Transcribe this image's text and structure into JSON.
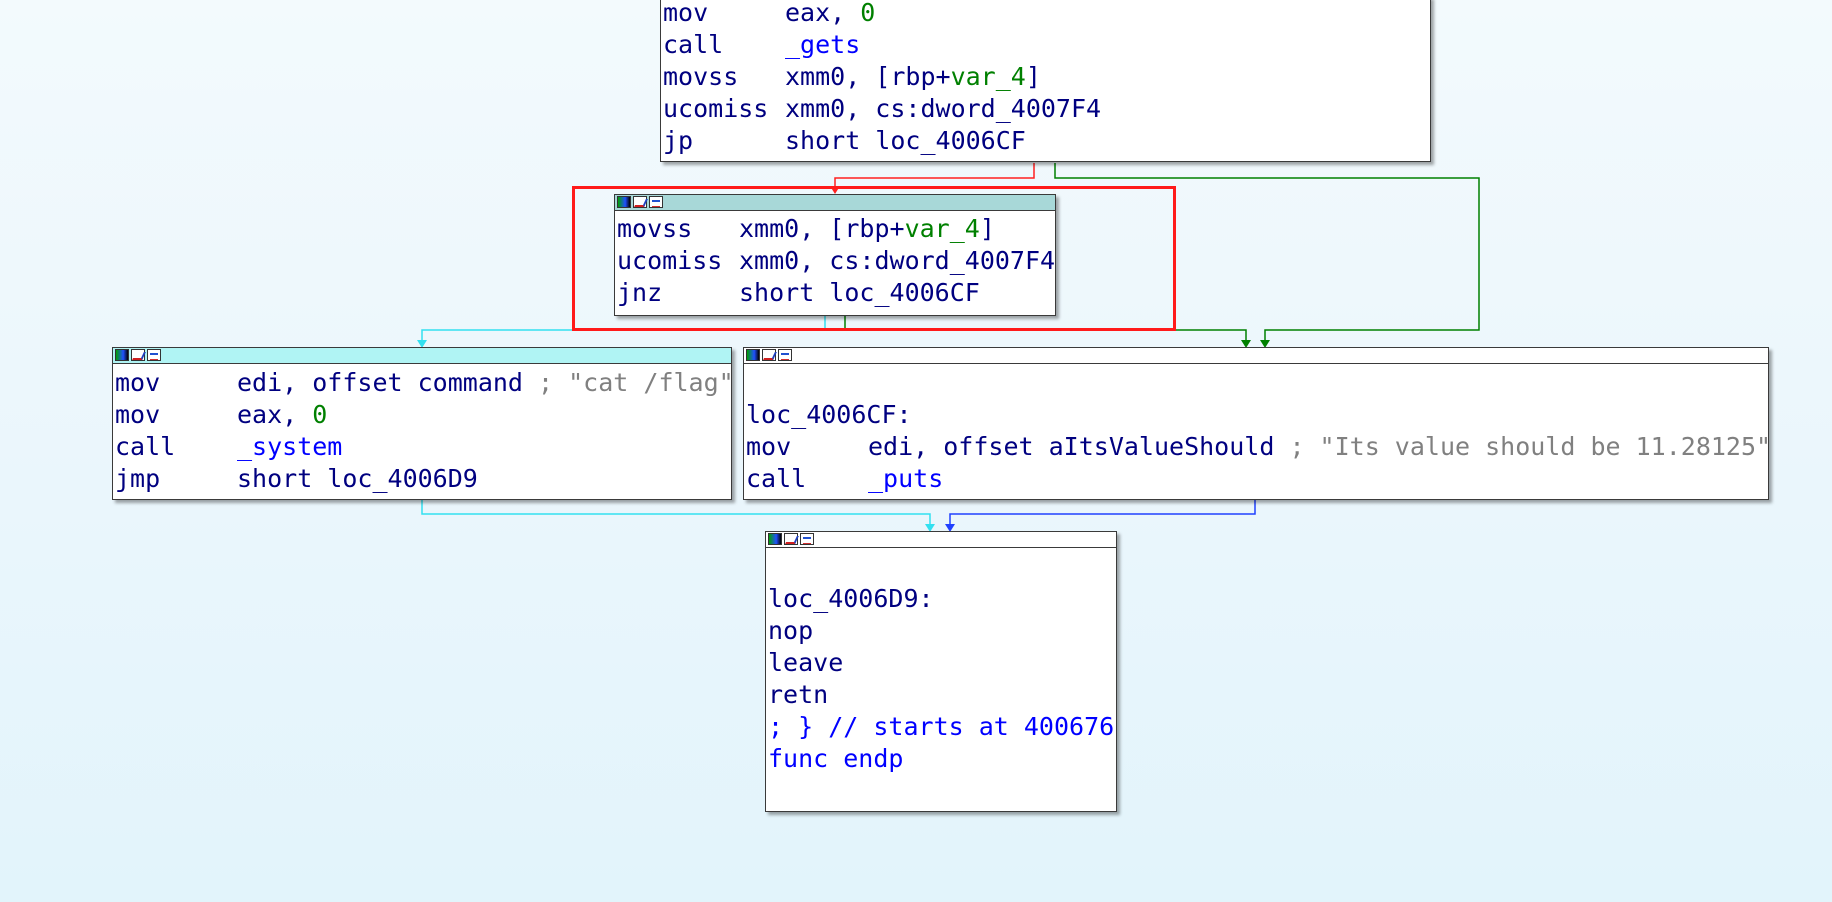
{
  "blocks": {
    "top": {
      "lines": [
        {
          "mn": "mov",
          "ops": [
            {
              "t": "eax, ",
              "c": "op"
            },
            {
              "t": "0",
              "c": "green"
            }
          ]
        },
        {
          "mn": "call",
          "ops": [
            {
              "t": "_gets",
              "c": "blue"
            }
          ]
        },
        {
          "mn": "movss",
          "ops": [
            {
              "t": "xmm0, [rbp+",
              "c": "op"
            },
            {
              "t": "var_4",
              "c": "green"
            },
            {
              "t": "]",
              "c": "op"
            }
          ]
        },
        {
          "mn": "ucomiss",
          "ops": [
            {
              "t": "xmm0, cs:dword_4007F4",
              "c": "op"
            }
          ]
        },
        {
          "mn": "jp",
          "ops": [
            {
              "t": "short loc_4006CF",
              "c": "op"
            }
          ]
        }
      ]
    },
    "mid": {
      "lines": [
        {
          "mn": "movss",
          "ops": [
            {
              "t": "xmm0, [rbp+",
              "c": "op"
            },
            {
              "t": "var_4",
              "c": "green"
            },
            {
              "t": "]",
              "c": "op"
            }
          ]
        },
        {
          "mn": "ucomiss",
          "ops": [
            {
              "t": "xmm0, cs:dword_4007F4",
              "c": "op"
            }
          ]
        },
        {
          "mn": "jnz",
          "ops": [
            {
              "t": "short loc_4006CF",
              "c": "op"
            }
          ]
        }
      ]
    },
    "left": {
      "lines": [
        {
          "mn": "mov",
          "ops": [
            {
              "t": "edi, offset command ",
              "c": "op"
            },
            {
              "t": "; \"cat /flag\"",
              "c": "gray"
            }
          ]
        },
        {
          "mn": "mov",
          "ops": [
            {
              "t": "eax, ",
              "c": "op"
            },
            {
              "t": "0",
              "c": "green"
            }
          ]
        },
        {
          "mn": "call",
          "ops": [
            {
              "t": "_system",
              "c": "blue"
            }
          ]
        },
        {
          "mn": "jmp",
          "ops": [
            {
              "t": "short loc_4006D9",
              "c": "op"
            }
          ]
        }
      ]
    },
    "right": {
      "lines": [
        {
          "raw": ""
        },
        {
          "raw": "loc_4006CF:",
          "c": "lbl"
        },
        {
          "mn": "mov",
          "ops": [
            {
              "t": "edi, offset aItsValueShould ",
              "c": "op"
            },
            {
              "t": "; \"Its value should be 11.28125\"",
              "c": "gray"
            }
          ]
        },
        {
          "mn": "call",
          "ops": [
            {
              "t": "_puts",
              "c": "blue"
            }
          ]
        }
      ]
    },
    "bottom": {
      "lines": [
        {
          "raw": ""
        },
        {
          "raw": "loc_4006D9:",
          "c": "lbl"
        },
        {
          "raw": "nop",
          "c": "lbl"
        },
        {
          "raw": "leave",
          "c": "lbl"
        },
        {
          "raw": "retn",
          "c": "lbl"
        },
        {
          "raw": "; } // starts at 400676",
          "c": "blue"
        },
        {
          "raw": "func endp",
          "c": "blue"
        },
        {
          "raw": ""
        }
      ]
    }
  },
  "colors": {
    "edge_false": "#ff2020",
    "edge_true": "#008000",
    "edge_jump": "#2040ff",
    "edge_fallthrough": "#33e0f0",
    "selected_header": "#a8d8d8",
    "current_header": "#b0f4f4",
    "highlight": "#ff1a1a"
  }
}
